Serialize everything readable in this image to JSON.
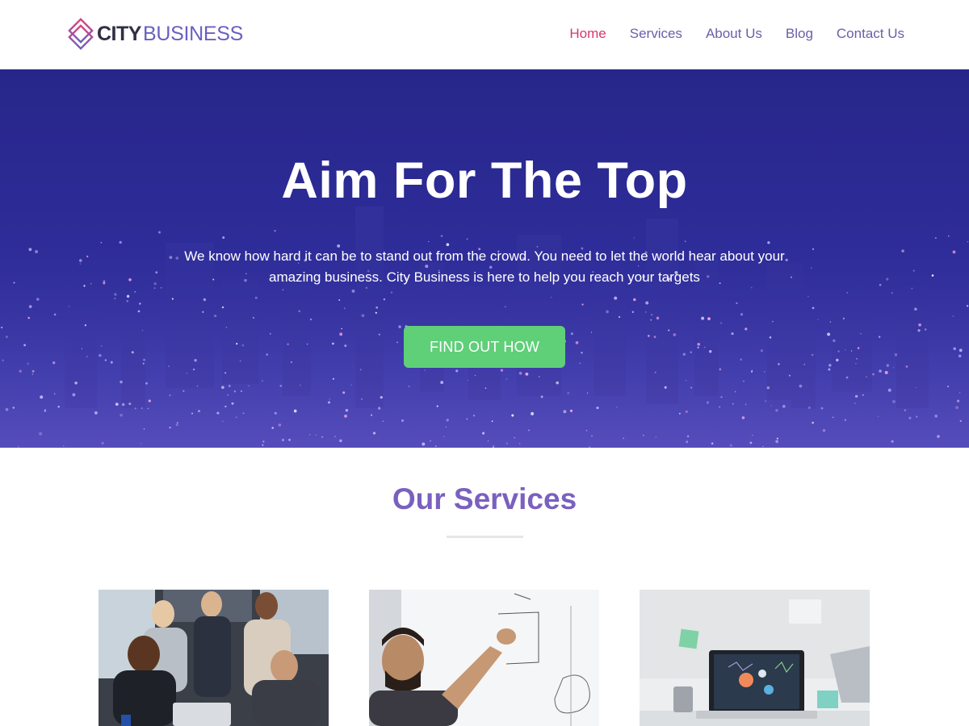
{
  "header": {
    "logo": {
      "city": "CITY",
      "business": "BUSINESS"
    },
    "nav": [
      {
        "label": "Home",
        "active": true
      },
      {
        "label": "Services",
        "active": false
      },
      {
        "label": "About Us",
        "active": false
      },
      {
        "label": "Blog",
        "active": false
      },
      {
        "label": "Contact Us",
        "active": false
      }
    ]
  },
  "hero": {
    "title": "Aim For The Top",
    "text": "We know how hard it can be to stand out from the crowd. You need to let the world hear about your amazing business. City Business is here to help you reach your targets",
    "button_label": "FIND OUT HOW",
    "button_color": "#5fcf78",
    "overlay_color": "#2a2a90"
  },
  "services": {
    "title": "Our Services",
    "cards": [
      {
        "image": "team-meeting-photo"
      },
      {
        "image": "whiteboard-planning-photo"
      },
      {
        "image": "laptop-analytics-photo"
      }
    ]
  },
  "colors": {
    "accent_purple": "#7a60bf",
    "nav_active": "#d6386e",
    "nav_text": "#6a5fa8"
  }
}
